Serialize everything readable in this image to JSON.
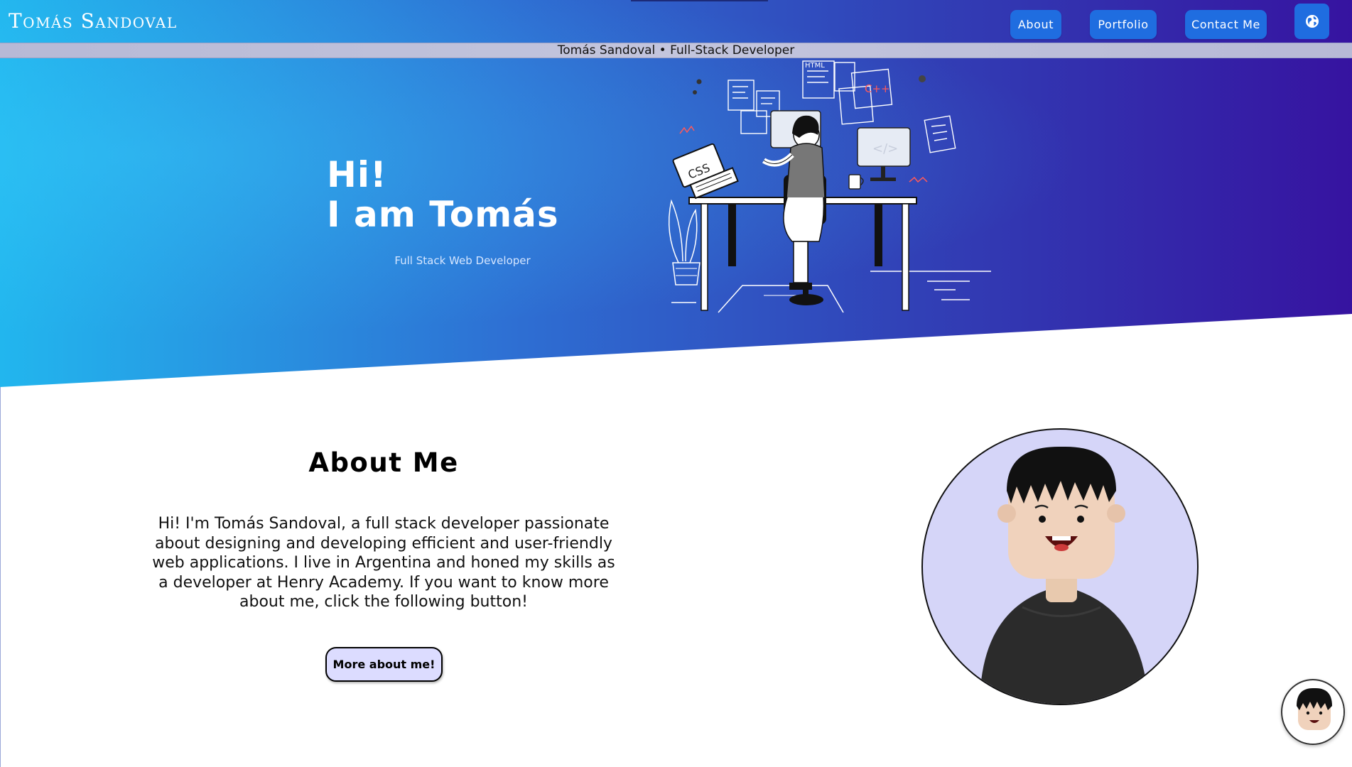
{
  "nav": {
    "brand": "Tomás Sandoval",
    "items": [
      {
        "label": "About"
      },
      {
        "label": "Portfolio"
      },
      {
        "label": "Contact Me"
      }
    ],
    "language_icon": "globe-icon"
  },
  "marquee": {
    "text": "Tomás Sandoval • Full-Stack Developer"
  },
  "hero": {
    "greeting": "Hi!",
    "intro": "I am Tomás",
    "subtitle": "Full Stack Web Developer",
    "illustration_labels": [
      "CSS",
      "HTML",
      "C++",
      "</>"
    ]
  },
  "about": {
    "heading": "About Me",
    "paragraph": "Hi! I'm Tomás Sandoval, a full stack developer passionate about designing and developing efficient and user-friendly web applications. I live in Argentina and honed my skills as a developer at Henry Academy. If you want to know more about me, click the following button!",
    "button_label": "More about me!"
  },
  "colors": {
    "gradient_start": "#22b6ee",
    "gradient_end": "#3613a0",
    "nav_button": "#1f6de0",
    "about_button_bg": "#dcdcff",
    "avatar_bg": "#d5d5f8"
  }
}
